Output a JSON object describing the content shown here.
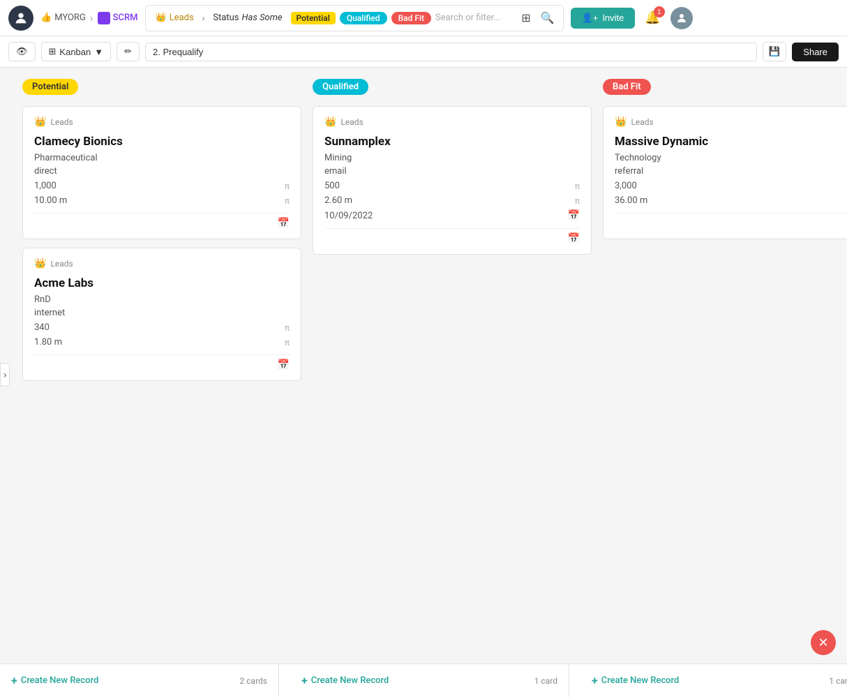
{
  "navbar": {
    "org_label": "MYORG",
    "scrm_label": "SCRM",
    "breadcrumb_sep": "›",
    "filter": {
      "leads_label": "Leads",
      "status_label": "Status",
      "has_some_label": "Has Some",
      "potential_label": "Potential",
      "qualified_label": "Qualified",
      "bad_fit_label": "Bad Fit",
      "search_placeholder": "Search or filter..."
    },
    "invite_label": "Invite",
    "notif_count": "1"
  },
  "toolbar": {
    "view_icon": "👁",
    "kanban_label": "Kanban",
    "pipeline_value": "2. Prequalify",
    "share_label": "Share"
  },
  "columns": [
    {
      "id": "potential",
      "label": "Potential",
      "label_style": "potential",
      "cards": [
        {
          "source": "Leads",
          "title": "Clamecy Bionics",
          "industry": "Pharmaceutical",
          "channel": "direct",
          "employees": "1,000",
          "revenue": "10.00 m",
          "date": null
        },
        {
          "source": "Leads",
          "title": "Acme Labs",
          "industry": "RnD",
          "channel": "internet",
          "employees": "340",
          "revenue": "1.80 m",
          "date": null
        }
      ],
      "footer_label": "Create New Record",
      "card_count": "2 cards"
    },
    {
      "id": "qualified",
      "label": "Qualified",
      "label_style": "qualified",
      "cards": [
        {
          "source": "Leads",
          "title": "Sunnamplex",
          "industry": "Mining",
          "channel": "email",
          "employees": "500",
          "revenue": "2.60 m",
          "date": "10/09/2022"
        }
      ],
      "footer_label": "Create New Record",
      "card_count": "1 card"
    },
    {
      "id": "bad-fit",
      "label": "Bad Fit",
      "label_style": "bad-fit",
      "cards": [
        {
          "source": "Leads",
          "title": "Massive Dynamic",
          "industry": "Technology",
          "channel": "referral",
          "employees": "3,000",
          "revenue": "36.00 m",
          "date": null
        }
      ],
      "footer_label": "Create New Record",
      "card_count": "1 car"
    }
  ]
}
